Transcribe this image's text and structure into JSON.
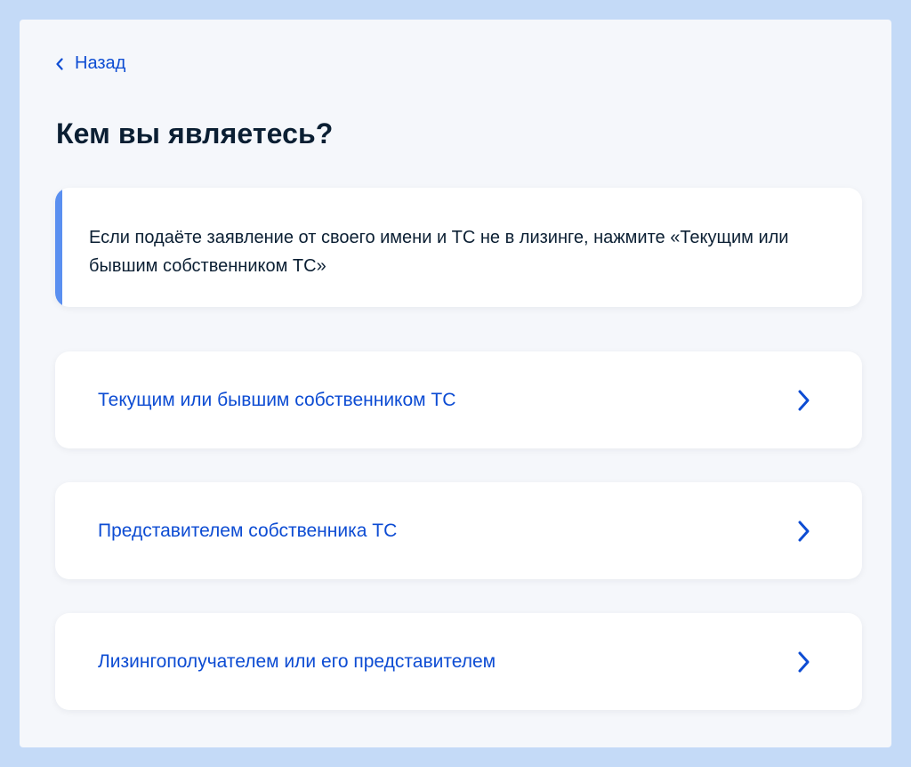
{
  "nav": {
    "back_label": "Назад",
    "back_icon": "chevron-left-icon"
  },
  "page": {
    "title": "Кем вы являетесь?"
  },
  "info": {
    "text": "Если подаёте заявление от своего имени и ТС не в лизинге, нажмите «Текущим или бывшим собственником ТС»"
  },
  "options": [
    {
      "label": "Текущим или бывшим собственником ТС",
      "icon": "chevron-right-icon"
    },
    {
      "label": "Представителем собственника ТС",
      "icon": "chevron-right-icon"
    },
    {
      "label": "Лизингополучателем или его представителем",
      "icon": "chevron-right-icon"
    }
  ],
  "colors": {
    "accent": "#0d4cd3",
    "info_bar": "#5a8ff0",
    "text": "#0b1f33",
    "page_background": "#f5f7fb",
    "outer_background": "#c4daf7"
  }
}
